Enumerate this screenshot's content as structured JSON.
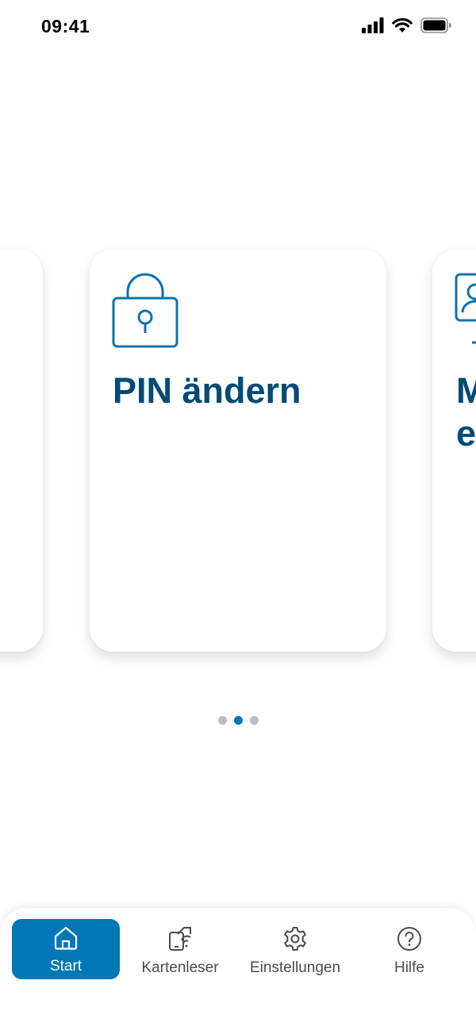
{
  "status_bar": {
    "time": "09:41",
    "icons": [
      "signal-icon",
      "wifi-icon",
      "battery-icon"
    ]
  },
  "carousel": {
    "cards": [
      {
        "title": "",
        "icon": "card-icon",
        "position": "left-partial"
      },
      {
        "title": "PIN ändern",
        "icon": "lock-icon",
        "position": "center"
      },
      {
        "title": "M\ne",
        "icon": "id-card-icon",
        "position": "right-partial"
      }
    ],
    "page_count": 3,
    "active_page": 2
  },
  "tab_bar": {
    "items": [
      {
        "label": "Start",
        "icon": "home-icon",
        "active": true
      },
      {
        "label": "Kartenleser",
        "icon": "card-reader-icon",
        "active": false
      },
      {
        "label": "Einstellungen",
        "icon": "gear-icon",
        "active": false
      },
      {
        "label": "Hilfe",
        "icon": "help-icon",
        "active": false
      }
    ]
  },
  "colors": {
    "accent": "#0077b6",
    "title": "#004b76",
    "dot_inactive": "#bdbdbd",
    "tab_inactive_text": "#4a4a4a"
  }
}
